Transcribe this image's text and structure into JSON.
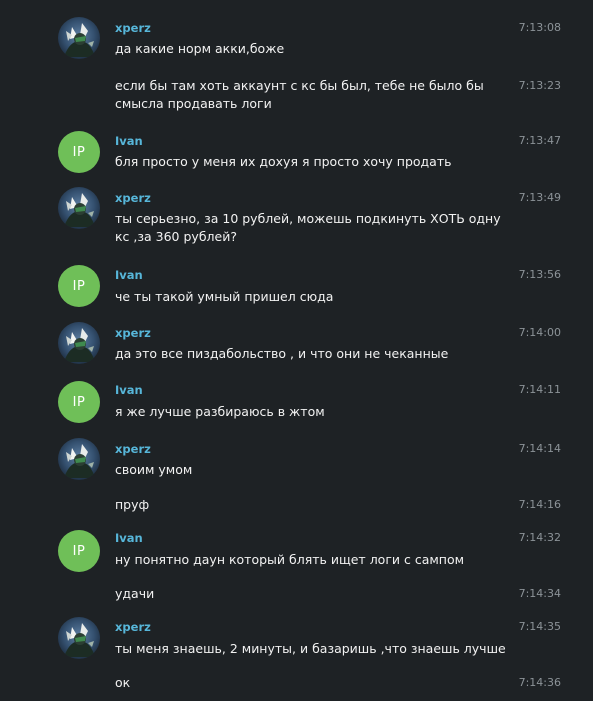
{
  "chat": {
    "messages": [
      {
        "sender": "xperz",
        "avatar": "anime-avatar",
        "text": "да какие норм акки,боже",
        "time": "7:13:08"
      },
      {
        "sender": "",
        "avatar": "",
        "text": "если бы там хоть аккаунт с кс бы был, тебе не было бы смысла продавать логи",
        "time": "7:13:23"
      },
      {
        "sender": "Ivan",
        "avatar": "IP",
        "text": "бля просто у меня их дохуя я просто хочу продать",
        "time": "7:13:47"
      },
      {
        "sender": "xperz",
        "avatar": "anime-avatar",
        "text": "ты серьезно, за 10 рублей, можешь подкинуть ХОТЬ одну кс ,за 360 рублей?",
        "time": "7:13:49"
      },
      {
        "sender": "Ivan",
        "avatar": "IP",
        "text": "че ты такой умный пришел сюда",
        "time": "7:13:56"
      },
      {
        "sender": "xperz",
        "avatar": "anime-avatar",
        "text": "да это все пиздабольство , и что они не чеканные",
        "time": "7:14:00"
      },
      {
        "sender": "Ivan",
        "avatar": "IP",
        "text": "я же лучше разбираюсь в жтом",
        "time": "7:14:11"
      },
      {
        "sender": "xperz",
        "avatar": "anime-avatar",
        "text": "своим умом",
        "time": "7:14:14"
      },
      {
        "sender": "",
        "avatar": "",
        "text": "пруф",
        "time": "7:14:16"
      },
      {
        "sender": "Ivan",
        "avatar": "IP",
        "text": "ну понятно даун который блять ищет логи с сампом",
        "time": "7:14:32"
      },
      {
        "sender": "",
        "avatar": "",
        "text": "удачи",
        "time": "7:14:34"
      },
      {
        "sender": "xperz",
        "avatar": "anime-avatar",
        "text": "ты меня знаешь, 2 минуты, и базаришь ,что знаешь лучше",
        "time": "7:14:35"
      },
      {
        "sender": "",
        "avatar": "",
        "text": "ок",
        "time": "7:14:36"
      }
    ]
  },
  "colors": {
    "background": "#1e2225",
    "name": "#57b6d9",
    "text": "#f2f2f2",
    "time": "#8c9398",
    "ivan_avatar": "#6fbf58"
  }
}
